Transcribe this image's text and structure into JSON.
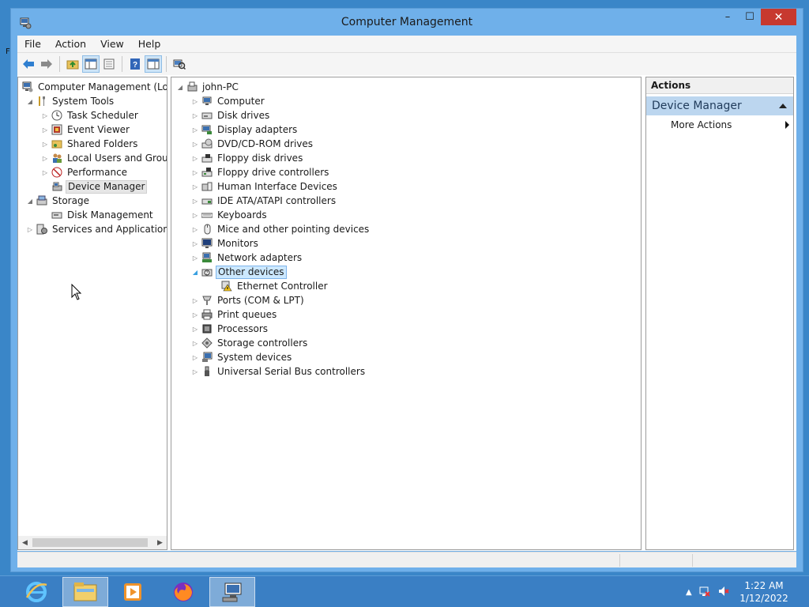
{
  "window": {
    "title": "Computer Management",
    "minimize": "–",
    "maximize": "☐",
    "close": "✕"
  },
  "menu": [
    "File",
    "Action",
    "View",
    "Help"
  ],
  "toolbar": {
    "buttons": [
      "back-arrow-icon",
      "forward-arrow-icon",
      "up-folder-icon",
      "console-tree-icon",
      "properties-icon",
      "help-icon",
      "action-pane-icon",
      "scan-hardware-icon"
    ]
  },
  "left_tree": {
    "root": "Computer Management (Local",
    "system_tools": "System Tools",
    "task_scheduler": "Task Scheduler",
    "event_viewer": "Event Viewer",
    "shared_folders": "Shared Folders",
    "local_users": "Local Users and Groups",
    "performance": "Performance",
    "device_manager": "Device Manager",
    "storage": "Storage",
    "disk_management": "Disk Management",
    "services": "Services and Applications"
  },
  "device_tree": {
    "root": "john-PC",
    "categories": [
      "Computer",
      "Disk drives",
      "Display adapters",
      "DVD/CD-ROM drives",
      "Floppy disk drives",
      "Floppy drive controllers",
      "Human Interface Devices",
      "IDE ATA/ATAPI controllers",
      "Keyboards",
      "Mice and other pointing devices",
      "Monitors",
      "Network adapters",
      "Other devices",
      "Ethernet Controller",
      "Ports (COM & LPT)",
      "Print queues",
      "Processors",
      "Storage controllers",
      "System devices",
      "Universal Serial Bus controllers"
    ]
  },
  "actions": {
    "header": "Actions",
    "section": "Device Manager",
    "more": "More Actions"
  },
  "taskbar": {
    "time": "1:22 AM",
    "date": "1/12/2022"
  }
}
